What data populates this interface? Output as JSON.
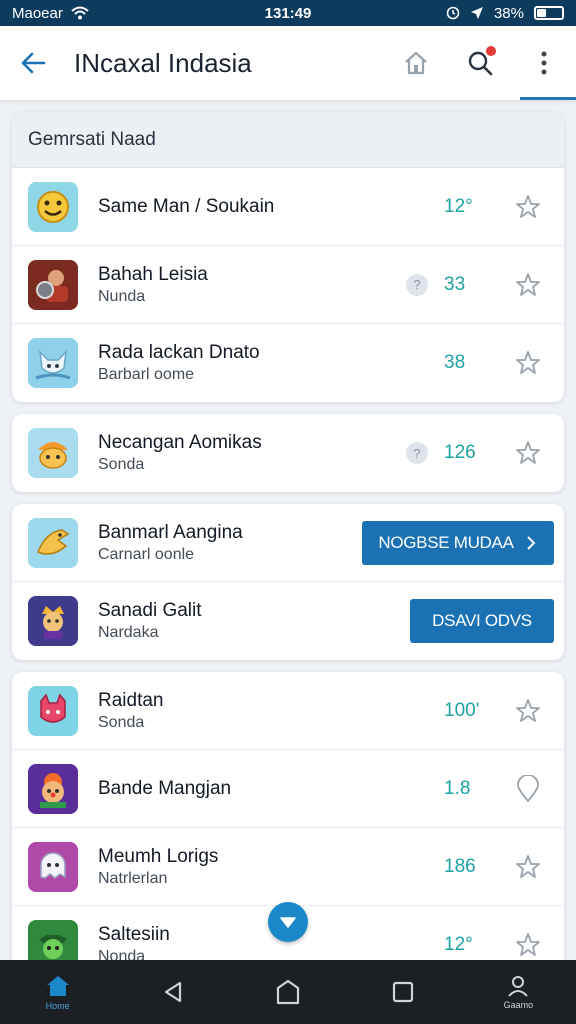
{
  "status_bar": {
    "carrier": "Maoear",
    "time": "131:49",
    "battery": "38%"
  },
  "app_bar": {
    "title": "INcaxal Indasia"
  },
  "section": {
    "header": "Gemrsati Naad"
  },
  "colors": {
    "accent": "#1a72b4",
    "number": "#1ea3a0",
    "status_bar": "#0d3b5e"
  },
  "rows": [
    {
      "name": "Same Man / Soukain",
      "sub": "",
      "value": "12°",
      "icon": "smiley-app-icon"
    },
    {
      "name": "Bahah Leisia",
      "sub": "Nunda",
      "value": "33",
      "icon": "warrior-app-icon"
    },
    {
      "name": "Rada lackan Dnato",
      "sub": "Barbarl oome",
      "value": "38",
      "icon": "fox-app-icon"
    },
    {
      "name": "Necangan Aomikas",
      "sub": "Sonda",
      "value": "126",
      "icon": "hat-creature-app-icon"
    },
    {
      "name": "Banmarl Aangina",
      "sub": "Carnarl oonle",
      "button": "NOGBSE MUDAA",
      "icon": "dragon-app-icon"
    },
    {
      "name": "Sanadi Galit",
      "sub": "Nardaka",
      "button": "DSAVI ODVS",
      "icon": "hero-app-icon"
    },
    {
      "name": "Raidtan",
      "sub": "Sonda",
      "value": "100'",
      "icon": "cat-app-icon"
    },
    {
      "name": "Bande Mangjan",
      "sub": "",
      "value": "1.8",
      "icon": "clown-app-icon"
    },
    {
      "name": "Meumh Lorigs",
      "sub": "Natrlerlan",
      "value": "186",
      "icon": "ghost-app-icon"
    },
    {
      "name": "Saltesiin",
      "sub": "Nonda",
      "value": "12°",
      "icon": "goblin-app-icon"
    }
  ],
  "bottom_nav": {
    "home_label": "Home",
    "profile_label": "Gaamo"
  }
}
